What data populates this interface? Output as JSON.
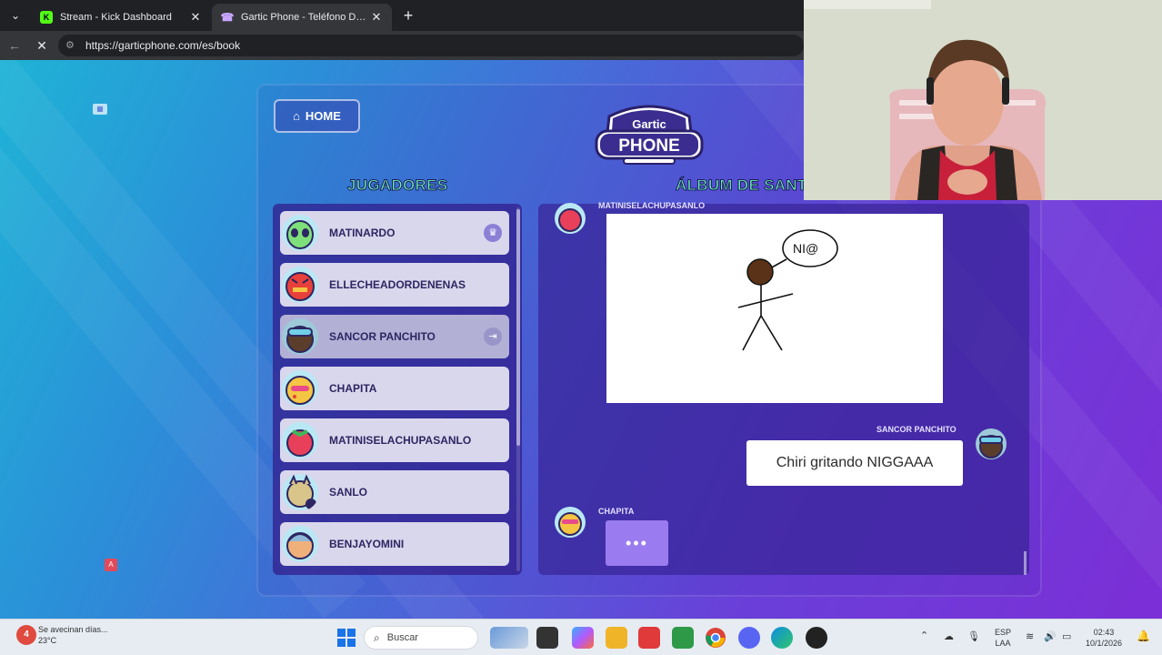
{
  "browser": {
    "tabs": [
      {
        "title": "Stream - Kick Dashboard",
        "active": false,
        "favicon": "kick-icon"
      },
      {
        "title": "Gartic Phone - Teléfono Descompuesto",
        "active": true,
        "favicon": "gartic-icon"
      }
    ],
    "url": "https://garticphone.com/es/book",
    "close_glyph": "✕",
    "new_tab_glyph": "+"
  },
  "game": {
    "home_label": "HOME",
    "logo": {
      "line1": "Gartic",
      "line2": "PHONE"
    },
    "players_title": "JUGADORES",
    "album_title": "ÁLBUM DE SANT",
    "players": [
      {
        "name": "MATINARDO",
        "badge": "crown-icon",
        "avatar_color": "#7ee07a"
      },
      {
        "name": "ELLECHEADORDENENAS",
        "badge": null,
        "avatar_color": "#e8403a"
      },
      {
        "name": "SANCOR PANCHITO",
        "badge": "exit-icon",
        "avatar_color": "#3b8fb0",
        "highlight": true
      },
      {
        "name": "CHAPITA",
        "badge": null,
        "avatar_color": "#f4c542"
      },
      {
        "name": "MATINISELACHUPASANLO",
        "badge": null,
        "avatar_color": "#e8405a"
      },
      {
        "name": "SANLO",
        "badge": null,
        "avatar_color": "#d9c48a"
      },
      {
        "name": "BENJAYOMINI",
        "badge": null,
        "avatar_color": "#8fb8d8"
      }
    ],
    "album": {
      "messages": [
        {
          "author": "MATINISELACHUPASANLO",
          "type": "drawing",
          "drawing_text": "NI@"
        },
        {
          "author": "SANCOR PANCHITO",
          "type": "text",
          "text": "Chiri gritando NIGGAAA"
        },
        {
          "author": "CHAPITA",
          "type": "typing",
          "text": "•••"
        }
      ]
    },
    "colors": {
      "title_green": "#69f0b5",
      "typing_purple": "#9b7bf0"
    }
  },
  "taskbar": {
    "weather_badge": "4",
    "weather_line1": "Se avecinan días...",
    "weather_line2": "23°C",
    "search_placeholder": "Buscar",
    "lang_line1": "ESP",
    "lang_line2": "LAA",
    "time": "02:43",
    "date": "10/1/2026"
  }
}
